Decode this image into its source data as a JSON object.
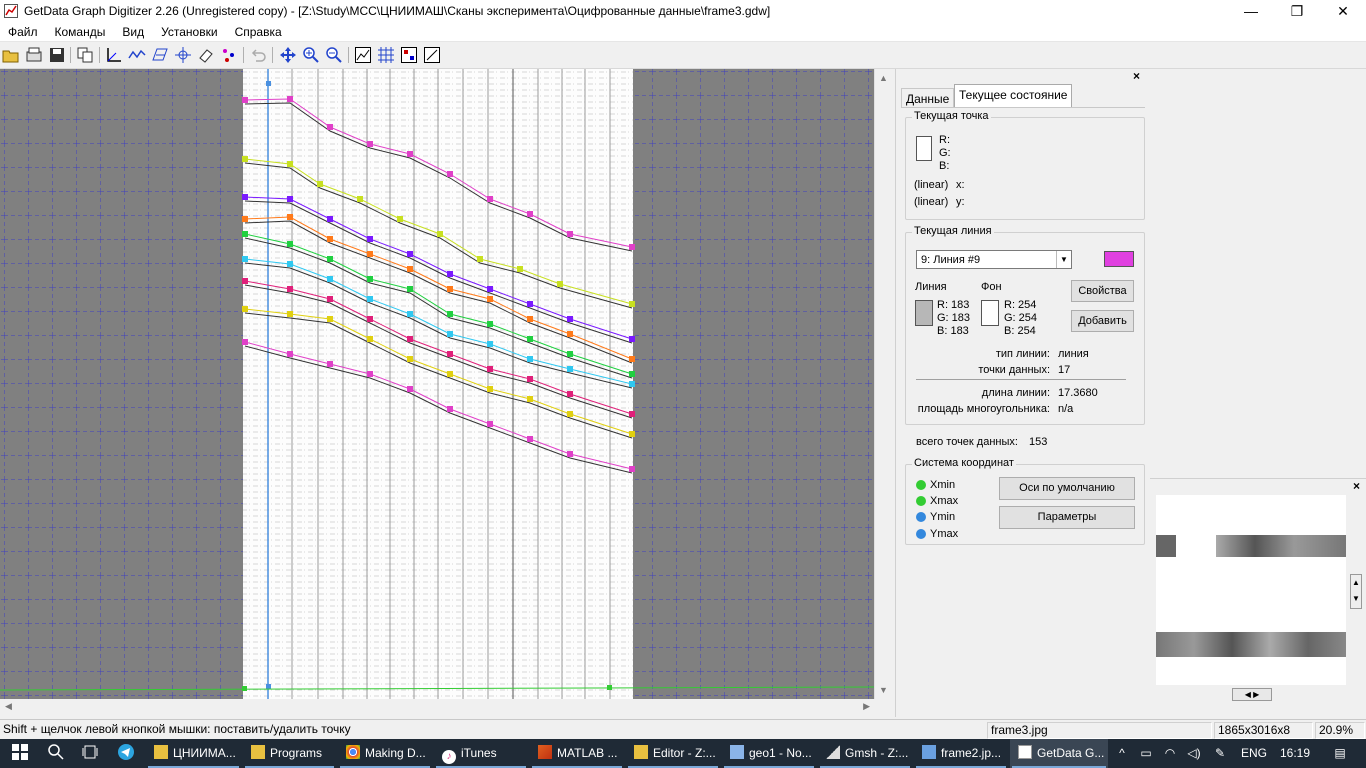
{
  "window": {
    "title": "GetData Graph Digitizer 2.26 (Unregistered copy) - [Z:\\Study\\MCC\\ЦНИИМАШ\\Сканы эксперимента\\Оцифрованные данные\\frame3.gdw]",
    "minimize": "—",
    "restore": "❐",
    "close": "✕"
  },
  "menu": [
    "Файл",
    "Команды",
    "Вид",
    "Установки",
    "Справка"
  ],
  "toolbar_icons": [
    "open-icon",
    "scan-icon",
    "save-icon",
    "copy-icon",
    "set-axes-icon",
    "line-mode-icon",
    "digitize-area-icon",
    "point-mode-icon",
    "eraser-icon",
    "point-capture-icon",
    "undo-icon",
    "move-icon",
    "zoom-in-icon",
    "zoom-out-icon",
    "show-image-icon",
    "grid-icon",
    "point-colors-icon",
    "axes-rect-icon"
  ],
  "panel": {
    "close": "×",
    "tabs": [
      "Данные",
      "Текущее состояние"
    ],
    "current_point": {
      "title": "Текущая точка",
      "r": "R:",
      "g": "G:",
      "b": "B:",
      "x_scale": "(linear)",
      "x": "x:",
      "y_scale": "(linear)",
      "y": "y:"
    },
    "current_line": {
      "title": "Текущая линия",
      "selected": "9: Линия #9",
      "line_color": "#e040e0",
      "line_label": "Линия",
      "bg_label": "Фон",
      "line_r": "R: 183",
      "line_g": "G: 183",
      "line_b": "B: 183",
      "bg_r": "R: 254",
      "bg_g": "G: 254",
      "bg_b": "B: 254",
      "line_swatch": "#b7b7b7",
      "bg_swatch": "#fefefe",
      "properties_button": "Свойства",
      "add_button": "Добавить",
      "type_label": "тип линии:",
      "type_value": "линия",
      "points_label": "точки данных:",
      "points_value": "17",
      "length_label": "длина линии:",
      "length_value": "17.3680",
      "area_label": "площадь многоугольника:",
      "area_value": "n/a"
    },
    "total_points_label": "всего точек данных:",
    "total_points_value": "153",
    "coords": {
      "title": "Система координат",
      "items": [
        {
          "label": "Xmin",
          "color": "#33cc33"
        },
        {
          "label": "Xmax",
          "color": "#33cc33"
        },
        {
          "label": "Ymin",
          "color": "#3388dd"
        },
        {
          "label": "Ymax",
          "color": "#3388dd"
        }
      ],
      "default_axes_button": "Оси по умолчанию",
      "parameters_button": "Параметры"
    }
  },
  "preview": {
    "close": "×",
    "prev": "◀",
    "next": "▶"
  },
  "status": {
    "hint": "Shift + щелчок левой кнопкой мышки: поставить/удалить точку",
    "file": "frame3.jpg",
    "size": "1865x3016x8",
    "zoom": "20.9%"
  },
  "taskbar": {
    "items": [
      "ЦНИИМА...",
      "Programs",
      "Making D...",
      "iTunes",
      "MATLAB ...",
      "Editor - Z:...",
      "geo1 - No...",
      "Gmsh - Z:...",
      "frame2.jp...",
      "GetData G..."
    ],
    "lang": "ENG",
    "time": "16:19"
  },
  "series_colors": [
    "#e040c8",
    "#c8e020",
    "#7a1aff",
    "#ff7a1a",
    "#20d040",
    "#30c8f0",
    "#e0207a",
    "#e0d010",
    "#e040c8"
  ]
}
